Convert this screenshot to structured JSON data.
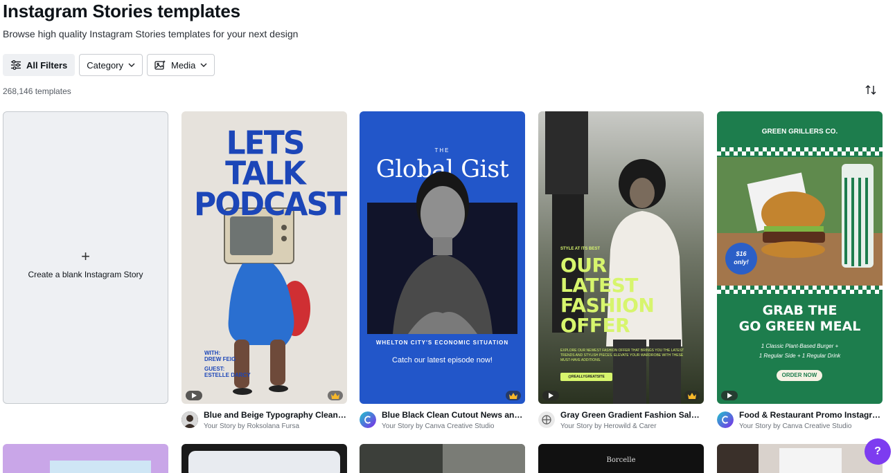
{
  "header": {
    "title": "Instagram Stories templates",
    "subtitle": "Browse high quality Instagram Stories templates for your next design"
  },
  "filters": {
    "all_filters": "All Filters",
    "category": "Category",
    "media": "Media"
  },
  "results": {
    "count": "268,146 templates"
  },
  "blank_card": {
    "plus": "+",
    "label": "Create a blank Instagram Story"
  },
  "templates": [
    {
      "title": "Blue and Beige Typography Clean N...",
      "author": "Your Story by Roksolana Fursa",
      "art": {
        "headline_l1": "LETS",
        "headline_l2": "TALK",
        "headline_l3": "PODCAST",
        "with": "WITH:",
        "with_name": "DREW FEIG",
        "guest": "GUEST:",
        "guest_name": "ESTELLE DARCY"
      }
    },
    {
      "title": "Blue Black Clean Cutout News and P...",
      "author": "Your Story by Canva Creative Studio",
      "art": {
        "the": "THE",
        "title": "Global Gist",
        "kicker": "WHELTON CITY'S ECONOMIC SITUATION",
        "cta": "Catch our latest episode now!"
      }
    },
    {
      "title": "Gray Green Gradient Fashion Sale Yo...",
      "author": "Your Story by Herowild & Carer",
      "art": {
        "style": "STYLE AT ITS BEST",
        "l1": "OUR",
        "l2": "LATEST",
        "l3": "FASHION",
        "l4": "OFFER",
        "small": "EXPLORE OUR NEWEST FASHION OFFER THAT BRINGS YOU THE LATEST TRENDS AND STYLISH PIECES. ELEVATE YOUR WARDROBE WITH THESE MUST-HAVE ADDITIONS.",
        "tag": "@REALLYGREATSITE"
      }
    },
    {
      "title": "Food & Restaurant Promo Instagram ...",
      "author": "Your Story by Canva Creative Studio",
      "art": {
        "brand": "GREEN GRILLERS CO.",
        "price_l1": "$16",
        "price_l2": "only!",
        "grab_l1": "GRAB THE",
        "grab_l2": "GO GREEN MEAL",
        "desc_l1": "1 Classic Plant-Based Burger +",
        "desc_l2": "1 Regular Side + 1 Regular Drink",
        "order": "ORDER NOW"
      }
    }
  ],
  "row2_art": {
    "borcelle": "Borcelle"
  },
  "help": {
    "label": "?"
  },
  "colors": {
    "accent": "#7d3cf0",
    "podcast_blue": "#1c46b8",
    "gist_blue": "#2256c9",
    "fashion_lime": "#d7f56d",
    "food_green": "#1d7d4d"
  }
}
